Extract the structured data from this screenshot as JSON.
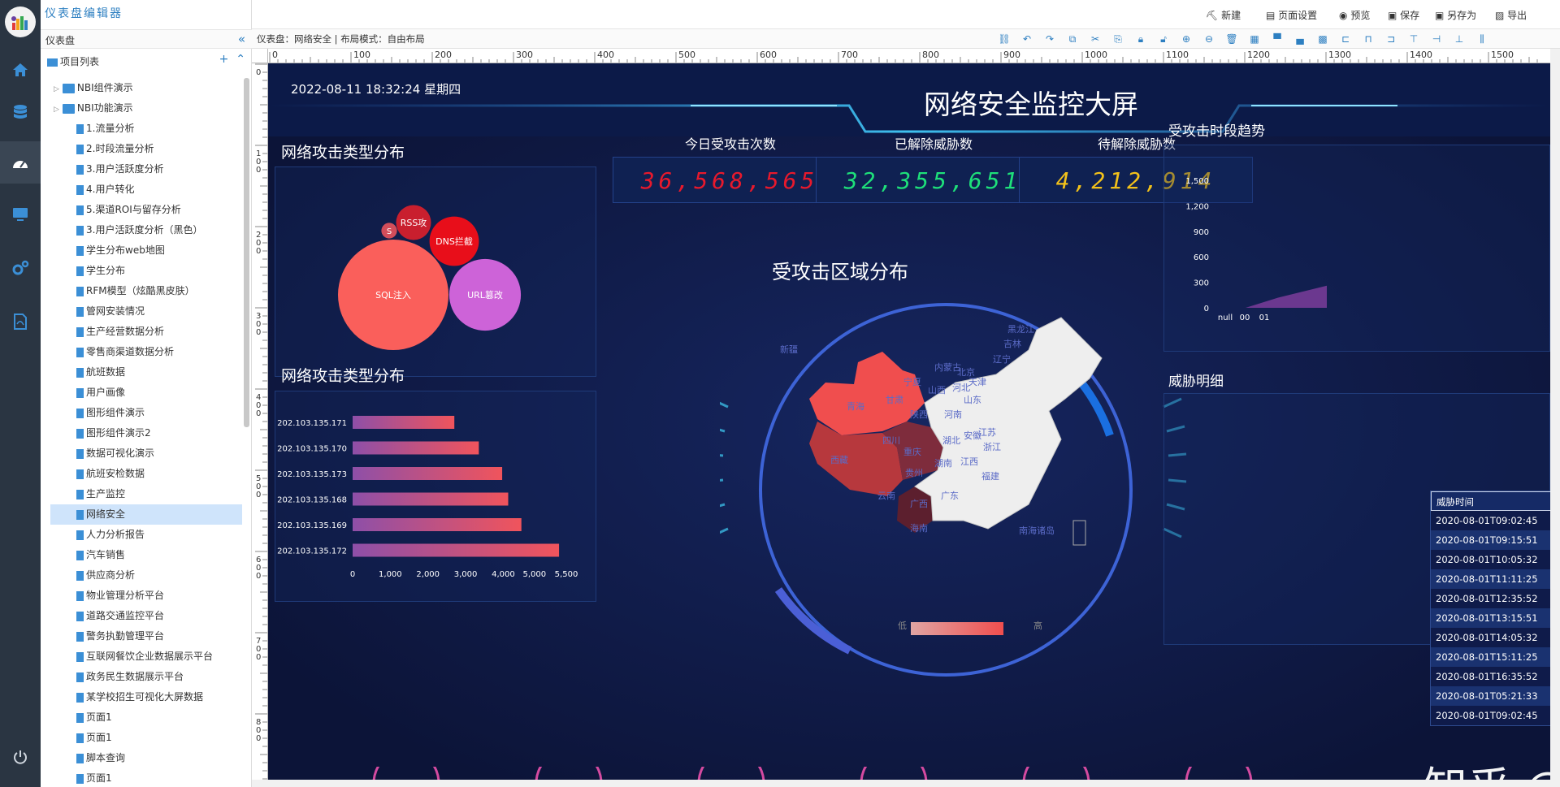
{
  "app": {
    "title": "仪表盘编辑器"
  },
  "panel": {
    "title": "仪表盘",
    "project_title": "项目列表"
  },
  "tree": {
    "folders": [
      "NBI组件演示",
      "NBI功能演示"
    ],
    "items": [
      "1.流量分析",
      "2.时段流量分析",
      "3.用户活跃度分析",
      "4.用户转化",
      "5.渠道ROI与留存分析",
      "3.用户活跃度分析（黑色）",
      "学生分布web地图",
      "学生分布",
      "RFM模型（炫酷黑皮肤）",
      "管网安装情况",
      "生产经营数据分析",
      "零售商渠道数据分析",
      "航班数据",
      "用户画像",
      "图形组件演示",
      "图形组件演示2",
      "数据可视化演示",
      "航班安检数据",
      "生产监控",
      "网络安全",
      "人力分析报告",
      "汽车销售",
      "供应商分析",
      "物业管理分析平台",
      "道路交通监控平台",
      "警务执勤管理平台",
      "互联网餐饮企业数据展示平台",
      "政务民生数据展示平台",
      "某学校招生可视化大屏数据",
      "页面1",
      "页面1",
      "脚本查询",
      "页面1"
    ],
    "selected_index": 19
  },
  "toolbar": {
    "new": "新建",
    "page_settings": "页面设置",
    "preview": "预览",
    "save": "保存",
    "save_as": "另存为",
    "export": "导出"
  },
  "breadcrumb": "仪表盘：网络安全 | 布局模式：自由布局",
  "ruler": {
    "h_ticks": [
      "0",
      "100",
      "200",
      "300",
      "400",
      "500",
      "600",
      "700",
      "800",
      "900",
      "1000",
      "1100",
      "1200",
      "1300",
      "1400",
      "1500"
    ],
    "v_ticks": [
      "0",
      "1\n0\n0",
      "2\n0\n0",
      "3\n0\n0",
      "4\n0\n0",
      "5\n0\n0",
      "6\n0\n0",
      "7\n0\n0",
      "8\n0\n0"
    ]
  },
  "dashboard": {
    "datetime": "2022-08-11 18:32:24 星期四",
    "title": "网络安全监控大屏",
    "kpis": [
      {
        "label": "今日受攻击次数",
        "value": "36,568,565",
        "color": "#e8192c"
      },
      {
        "label": "已解除威胁数",
        "value": "32,355,651",
        "color": "#1ee07a"
      },
      {
        "label": "待解除威胁数",
        "value": "4,212,914",
        "color": "#f2c11a"
      }
    ],
    "bubble_panel_title": "网络攻击类型分布",
    "bar_panel_title": "网络攻击类型分布",
    "map_title": "受攻击区域分布",
    "map_legend": {
      "low": "低",
      "high": "高"
    },
    "trend_title": "受攻击时段趋势",
    "threat_title": "威胁明细",
    "threat_header": "威胁时间",
    "threat_rows": [
      "2020-08-01T09:02:45",
      "2020-08-01T09:15:51",
      "2020-08-01T10:05:32",
      "2020-08-01T11:11:25",
      "2020-08-01T12:35:52",
      "2020-08-01T13:15:51",
      "2020-08-01T14:05:32",
      "2020-08-01T15:11:25",
      "2020-08-01T16:35:52",
      "2020-08-01T05:21:33",
      "2020-08-01T09:02:45"
    ],
    "provinces": [
      "新疆",
      "西藏",
      "青海",
      "甘肃",
      "内蒙古",
      "黑龙江",
      "吉林",
      "辽宁",
      "北京",
      "天津",
      "河北",
      "山东",
      "山西",
      "宁夏",
      "陕西",
      "河南",
      "江苏",
      "安徽",
      "湖北",
      "四川",
      "重庆",
      "浙江",
      "湖南",
      "江西",
      "贵州",
      "福建",
      "云南",
      "广西",
      "广东",
      "海南",
      "南海诸岛"
    ]
  },
  "watermark": "知乎 @NBI可视化",
  "chart_data": [
    {
      "type": "bubble",
      "title": "网络攻击类型分布",
      "categories": [
        "SQL注入",
        "URL篡改",
        "DNS拦截",
        "RSS攻",
        "S"
      ],
      "values": [
        100,
        42,
        20,
        10,
        2
      ],
      "colors": [
        "#fa5f5b",
        "#cd63d8",
        "#e80e1a",
        "#c91f2e",
        "#d24d5a"
      ]
    },
    {
      "type": "bar",
      "orientation": "horizontal",
      "title": "网络攻击类型分布",
      "categories": [
        "202.103.135.171",
        "202.103.135.170",
        "202.103.135.173",
        "202.103.135.168",
        "202.103.135.169",
        "202.103.135.172"
      ],
      "values": [
        2700,
        3350,
        3970,
        4130,
        4480,
        5480
      ],
      "x_ticks": [
        "0",
        "1,000",
        "2,000",
        "3,000",
        "4,000",
        "5,000",
        "5,500"
      ],
      "xlim": [
        0,
        5500
      ]
    },
    {
      "type": "area",
      "title": "受攻击时段趋势",
      "y_ticks": [
        "0",
        "300",
        "600",
        "900",
        "1,200",
        "1,500"
      ],
      "x_ticks": [
        "null",
        "00",
        "01"
      ],
      "ylim": [
        0,
        1500
      ],
      "series": [
        {
          "values": [
            0,
            0,
            120,
            260
          ]
        }
      ]
    }
  ]
}
